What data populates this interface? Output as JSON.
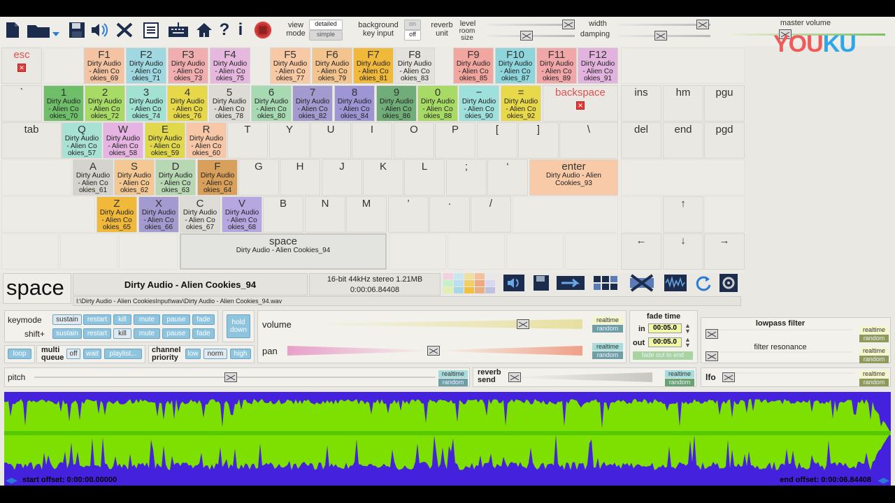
{
  "toolbar": {
    "view_mode_label": "view\nmode",
    "view_detailed": "detailed",
    "view_simple": "simple",
    "bg_input_label": "background\nkey input",
    "bg_on": "on",
    "bg_off": "off",
    "reverb_unit_label": "reverb\nunit",
    "level_label": "level",
    "room_size_label": "room\nsize",
    "width_label": "width",
    "damping_label": "damping",
    "master_volume_label": "master volume"
  },
  "watermark": {
    "text_a": "YOU",
    "text_b": "KU"
  },
  "keys": {
    "esc": "esc",
    "f1": "F1",
    "f2": "F2",
    "f3": "F3",
    "f4": "F4",
    "f5": "F5",
    "f6": "F6",
    "f7": "F7",
    "f8": "F8",
    "f9": "F9",
    "f10": "F10",
    "f11": "F11",
    "f12": "F12",
    "grave": "`",
    "k1": "1",
    "k2": "2",
    "k3": "3",
    "k4": "4",
    "k5": "5",
    "k6": "6",
    "k7": "7",
    "k8": "8",
    "k9": "9",
    "k0": "0",
    "minus": "−",
    "equals": "=",
    "backspace": "backspace",
    "ins": "ins",
    "hm": "hm",
    "pgu": "pgu",
    "tab": "tab",
    "q": "Q",
    "w": "W",
    "e": "E",
    "r": "R",
    "t": "T",
    "y": "Y",
    "u": "U",
    "i": "I",
    "o": "O",
    "p": "P",
    "lbr": "[",
    "rbr": "]",
    "bslash": "\\",
    "del": "del",
    "end": "end",
    "pgd": "pgd",
    "a": "A",
    "s": "S",
    "d": "D",
    "f": "F",
    "g": "G",
    "h": "H",
    "j": "J",
    "k": "K",
    "l": "L",
    "semi": ";",
    "quote": "‘",
    "enter": "enter",
    "z": "Z",
    "x": "X",
    "c": "C",
    "v": "V",
    "b": "B",
    "n": "N",
    "m": "M",
    "comma": "’",
    "period": "·",
    "slash": "/",
    "up": "↑",
    "left": "←",
    "down": "↓",
    "right": "→",
    "space": "space"
  },
  "samples": {
    "f1": "Dirty Audio - Alien Co okies_69",
    "f2": "Dirty Audio - Alien Co okies_71",
    "f3": "Dirty Audio - Alien Co okies_73",
    "f4": "Dirty Audio - Alien Co okies_75",
    "f5": "Dirty Audio - Alien Co okies_77",
    "f6": "Dirty Audio - Alien Co okies_79",
    "f7": "Dirty Audio - Alien Co okies_81",
    "f8": "Dirty Audio - Alien Co okies_83",
    "f9": "Dirty Audio - Alien Co okies_85",
    "f10": "Dirty Audio - Alien Co okies_87",
    "f11": "Dirty Audio - Alien Co okies_89",
    "f12": "Dirty Audio - Alien Co okies_91",
    "k1": "Dirty Audio - Alien Co okies_70",
    "k2": "Dirty Audio - Alien Co okies_72",
    "k3": "Dirty Audio - Alien Co okies_74",
    "k4": "Dirty Audio - Alien Co okies_76",
    "k5": "Dirty Audio - Alien Co okies_78",
    "k6": "Dirty Audio - Alien Co okies_80",
    "k7": "Dirty Audio - Alien Co okies_82",
    "k8": "Dirty Audio - Alien Co okies_84",
    "k9": "Dirty Audio - Alien Co okies_86",
    "k0": "Dirty Audio - Alien Co okies_88",
    "minus": "Dirty Audio - Alien Co okies_90",
    "equals": "Dirty Audio - Alien Co okies_92",
    "q": "Dirty Audio - Alien Co okies_57",
    "w": "Dirty Audio - Alien Co okies_58",
    "e": "Dirty Audio - Alien Co okies_59",
    "r": "Dirty Audio - Alien Co okies_60",
    "a": "Dirty Audio - Alien Co okies_61",
    "s": "Dirty Audio - Alien Co okies_62",
    "d": "Dirty Audio - Alien Co okies_63",
    "f": "Dirty Audio - Alien Co okies_64",
    "enter": "Dirty Audio - Alien Cookies_93",
    "z": "Dirty Audio - Alien Co okies_65",
    "x": "Dirty Audio - Alien Co okies_66",
    "c": "Dirty Audio - Alien Co okies_67",
    "v": "Dirty Audio - Alien Co okies_68",
    "space": "Dirty Audio - Alien Cookies_94"
  },
  "colors": {
    "f1": "#f3c3a2",
    "f2": "#9fd8e0",
    "f3": "#f1aeb0",
    "f4": "#e6b8df",
    "f5": "#f8c9a5",
    "f6": "#f3c48e",
    "f7": "#f1b93a",
    "f8": "#e3e2dc",
    "f9": "#f2a6a0",
    "f10": "#8ed5dc",
    "f11": "#f1a7a8",
    "f12": "#e3b3e0",
    "k1": "#6fbf6a",
    "k2": "#a8db66",
    "k3": "#a2e2d2",
    "k4": "#e7d84a",
    "k5": "#dcdbd5",
    "k6": "#a7d9b3",
    "k7": "#a39bd0",
    "k8": "#9d95d4",
    "k9": "#71ad78",
    "k0": "#a8db66",
    "minus": "#9ee0dc",
    "equals": "#e8d94a",
    "q": "#a8e2d4",
    "w": "#e5b4e3",
    "e": "#e2d84c",
    "r": "#f8c7a7",
    "a": "#d4d3cd",
    "s": "#f3c893",
    "d": "#b8d7b3",
    "f": "#d8a05a",
    "enter": "#f8caa8",
    "z": "#f1b93a",
    "x": "#a39bd0",
    "c": "#dddcd6",
    "v": "#b6a7e1",
    "space": "#e3e3df"
  },
  "info": {
    "key_name": "space",
    "sample_name": "Dirty Audio - Alien Cookies_94",
    "format": "16-bit 44kHz stereo 1.21MB",
    "duration": "0:00:06.84408",
    "path": "I:\\Dirty Audio - Alien CookiesInput\\wav\\Dirty Audio - Alien Cookies_94.wav"
  },
  "controls": {
    "keymode_label": "keymode",
    "shift_label": "shift+",
    "sustain": "sustain",
    "restart": "restart",
    "kill": "kill",
    "mute": "mute",
    "pause": "pause",
    "fade": "fade",
    "hold_down": "hold\ndown",
    "loop": "loop",
    "multi_queue_label": "multi\nqueue",
    "mq_off": "off",
    "mq_wait": "wait",
    "mq_playlist": "playlist...",
    "channel_priority_label": "channel\npriority",
    "cp_low": "low",
    "cp_norm": "norm",
    "cp_high": "high",
    "volume_label": "volume",
    "pan_label": "pan",
    "realtime": "realtime",
    "random": "random",
    "fade_time_label": "fade time",
    "fade_in_label": "in",
    "fade_in_value": "00:05.0",
    "fade_out_label": "out",
    "fade_out_value": "00:05.0",
    "fade_out_to_end": "fade out to end",
    "lowpass_label": "lowpass filter",
    "filter_res_label": "filter resonance",
    "pitch_label": "pitch",
    "reverb_send_label": "reverb\nsend",
    "lfo_label": "lfo"
  },
  "waveform": {
    "start_offset": "start offset: 0:00:00.00000",
    "end_offset": "end offset: 0:00:06.84408"
  }
}
